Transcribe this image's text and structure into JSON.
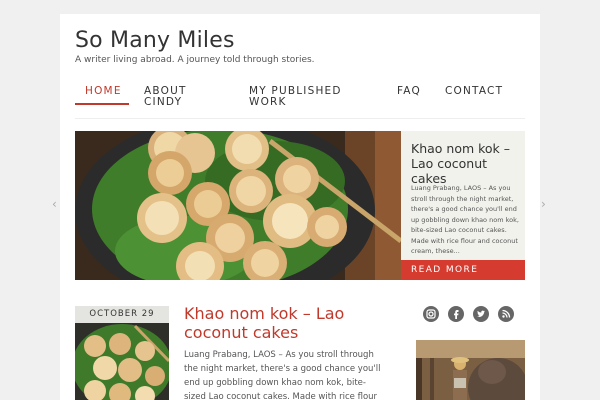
{
  "site": {
    "title": "So Many Miles",
    "tagline": "A writer living abroad. A journey told through stories."
  },
  "nav": {
    "items": [
      {
        "label": "HOME"
      },
      {
        "label": "ABOUT\nCINDY"
      },
      {
        "label": "MY PUBLISHED\nWORK"
      },
      {
        "label": "FAQ"
      },
      {
        "label": "CONTACT"
      }
    ]
  },
  "slider": {
    "title": "Khao nom kok – Lao coconut cakes",
    "excerpt": "Luang Prabang, LAOS – As you stroll through the night market, there's a good chance you'll end up gobbling down khao nom kok, bite-sized Lao coconut cakes. Made with rice flour and coconut cream, these...",
    "read_more": "READ MORE",
    "prev_icon": "chevron-left-icon",
    "next_icon": "chevron-right-icon"
  },
  "post": {
    "date": "OCTOBER 29",
    "title": "Khao nom kok – Lao coconut cakes",
    "excerpt": "Luang Prabang, LAOS – As you stroll through the night market, there's a good chance you'll end up gobbling down khao nom kok, bite-sized Lao coconut cakes. Made with rice flour and coconut"
  },
  "social": {
    "icons": [
      "instagram-icon",
      "facebook-icon",
      "twitter-icon",
      "rss-icon"
    ]
  },
  "colors": {
    "accent": "#c0392b",
    "read_more_bg": "#d63b2f",
    "panel_bg": "#f2f2ed"
  }
}
